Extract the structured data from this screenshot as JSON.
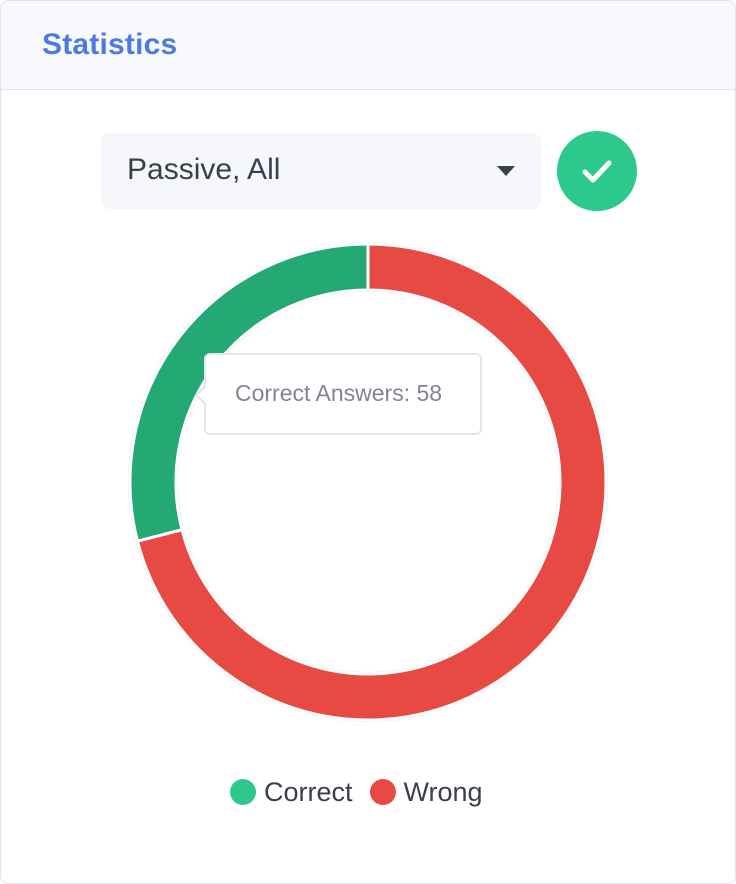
{
  "header": {
    "title": "Statistics"
  },
  "filter": {
    "selected_value": "Passive, All",
    "caret_icon": "caret-down-icon"
  },
  "confirm_button": {
    "icon": "check-icon",
    "color": "#2dc98c"
  },
  "tooltip": {
    "text": "Correct Answers: 58"
  },
  "chart_data": {
    "type": "pie",
    "variant": "doughnut",
    "categories": [
      "Correct",
      "Wrong"
    ],
    "values": [
      58,
      142
    ],
    "colors": [
      "#24a874",
      "#e64a42"
    ],
    "legend_colors": [
      "#2dc98c",
      "#e64a42"
    ],
    "legend_position": "bottom"
  },
  "legend": {
    "items": [
      {
        "label": "Correct",
        "color": "#2dc98c"
      },
      {
        "label": "Wrong",
        "color": "#e64a42"
      }
    ]
  }
}
